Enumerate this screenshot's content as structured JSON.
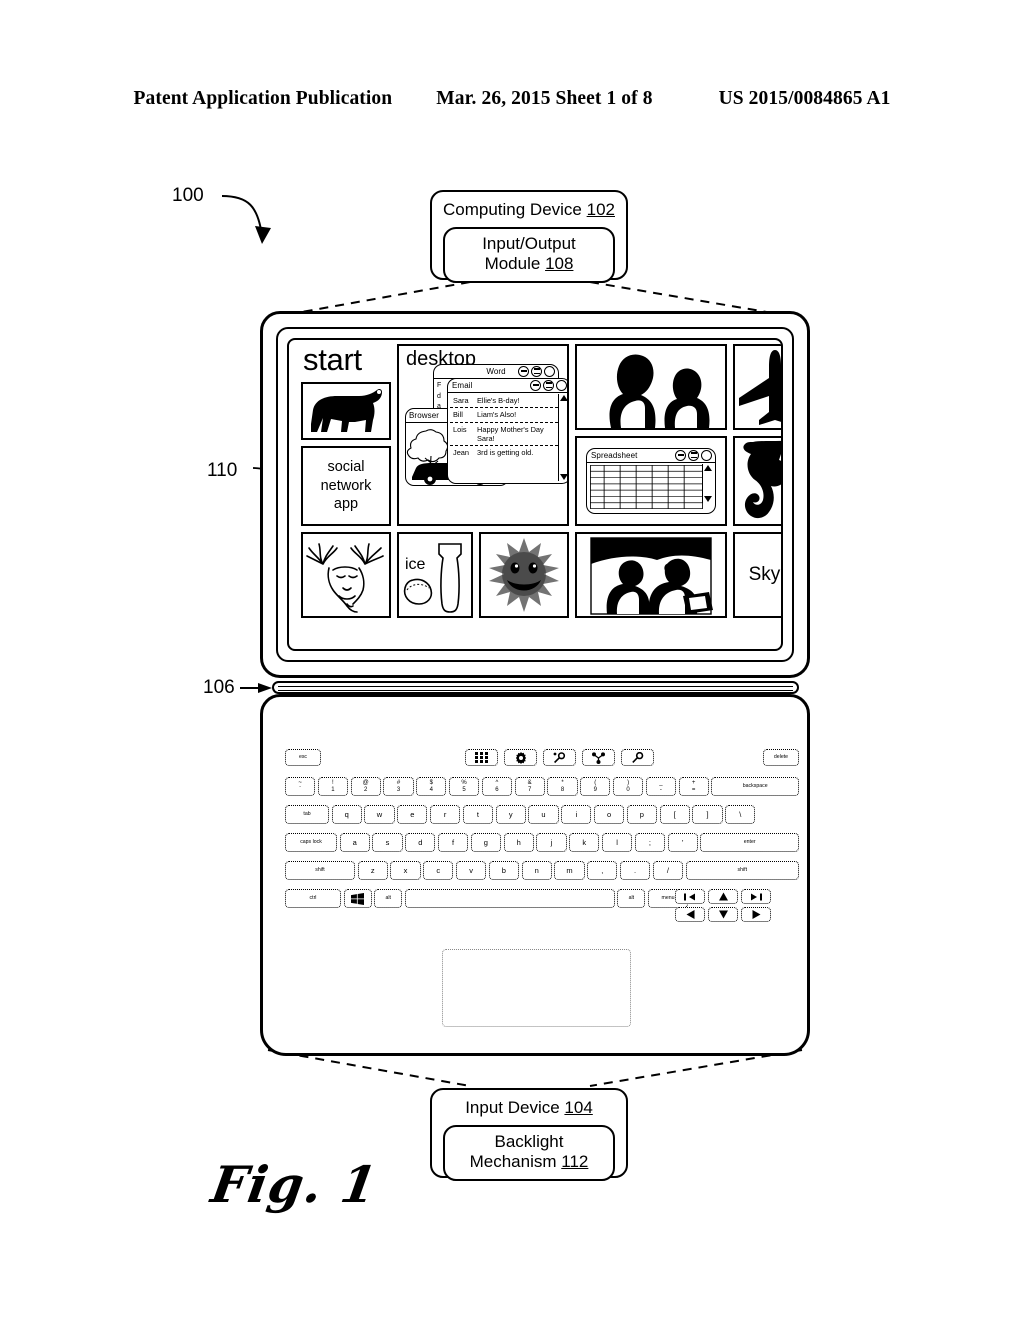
{
  "header": {
    "publication": "Patent Application Publication",
    "date_sheet": "Mar. 26, 2015  Sheet 1 of 8",
    "pub_number": "US 2015/0084865 A1"
  },
  "figure": {
    "caption": "Fig. 1",
    "reference_numerals": {
      "system": "100",
      "input_device": "104",
      "hinge": "106",
      "display_device": "110"
    }
  },
  "callout_top": {
    "title": "Computing Device",
    "title_num": "102",
    "inner_line1": "Input/Output",
    "inner_line2": "Module",
    "inner_num": "108"
  },
  "callout_bottom": {
    "title": "Input Device",
    "title_num": "104",
    "inner_line1": "Backlight",
    "inner_line2": "Mechanism",
    "inner_num": "112"
  },
  "start_screen": {
    "start_label": "start",
    "tiles": [
      {
        "name": "dog-tile",
        "label": "",
        "icon": "dog-silhouette"
      },
      {
        "name": "social-network-tile",
        "label": "social network app",
        "icon": "text"
      },
      {
        "name": "deer-tile",
        "label": "",
        "icon": "deer-head"
      },
      {
        "name": "desktop-tile",
        "label": "desktop",
        "icon": "windows-group"
      },
      {
        "name": "ice-tile",
        "label": "ice",
        "icon": "cocktail-shaker-lime"
      },
      {
        "name": "emoji-tile",
        "label": "",
        "icon": "smiley-sun"
      },
      {
        "name": "people-tile",
        "label": "",
        "icon": "father-and-child-photo"
      },
      {
        "name": "spreadsheet-tile",
        "label": "Spreadsheet",
        "icon": "spreadsheet-window"
      },
      {
        "name": "family-tile",
        "label": "",
        "icon": "family-group-photo"
      },
      {
        "name": "airplane-tile",
        "label": "",
        "icon": "airplane-silhouette"
      },
      {
        "name": "monkey-tile",
        "label": "",
        "icon": "monkey-silhouette"
      },
      {
        "name": "skype-tile",
        "label": "Skype",
        "icon": "text"
      }
    ],
    "social_lines": [
      "social",
      "network",
      "app"
    ],
    "desktop_label": "desktop",
    "ice_label": "ice",
    "skype_label": "Skype",
    "windows": {
      "word": {
        "title": "Word"
      },
      "browser": {
        "title": "Browser"
      },
      "spreadsheet": {
        "title": "Spreadsheet"
      },
      "email": {
        "title": "Email",
        "messages": [
          {
            "sender": "Sara",
            "subject": "Ellie's B-day!"
          },
          {
            "sender": "Bill",
            "subject": "Liam's Also!"
          },
          {
            "sender": "Lois",
            "subject": "Happy Mother's Day Sara!"
          },
          {
            "sender": "Jean",
            "subject": "3rd is getting old."
          }
        ]
      }
    }
  },
  "keyboard": {
    "fn_row": [
      {
        "label": "esc",
        "icon": ""
      },
      {
        "label": "",
        "icon": "start-grid-icon"
      },
      {
        "label": "",
        "icon": "gear-icon"
      },
      {
        "label": "",
        "icon": "magnifier-icon"
      },
      {
        "label": "",
        "icon": "share-icon"
      },
      {
        "label": "",
        "icon": "search-icon"
      },
      {
        "label": "delete",
        "icon": ""
      }
    ],
    "number_row": [
      {
        "top": "~",
        "bottom": "`"
      },
      {
        "top": "!",
        "bottom": "1"
      },
      {
        "top": "@",
        "bottom": "2"
      },
      {
        "top": "#",
        "bottom": "3"
      },
      {
        "top": "$",
        "bottom": "4"
      },
      {
        "top": "%",
        "bottom": "5"
      },
      {
        "top": "^",
        "bottom": "6"
      },
      {
        "top": "&",
        "bottom": "7"
      },
      {
        "top": "*",
        "bottom": "8"
      },
      {
        "top": "(",
        "bottom": "9"
      },
      {
        "top": ")",
        "bottom": "0"
      },
      {
        "top": "_",
        "bottom": "-"
      },
      {
        "top": "+",
        "bottom": "="
      }
    ],
    "backspace_label": "backspace",
    "q_row": [
      "tab",
      "q",
      "w",
      "e",
      "r",
      "t",
      "y",
      "u",
      "i",
      "o",
      "p",
      "[",
      "]",
      "\\"
    ],
    "tab_label": "tab",
    "a_row": [
      "a",
      "s",
      "d",
      "f",
      "g",
      "h",
      "j",
      "k",
      "l",
      ";",
      "'"
    ],
    "caps_label": "caps lock",
    "enter_label": "enter",
    "z_row": [
      "z",
      "x",
      "c",
      "v",
      "b",
      "n",
      "m",
      ",",
      ".",
      "/"
    ],
    "shift_label": "shift",
    "bottom_row": [
      {
        "label": "ctrl",
        "icon": ""
      },
      {
        "label": "",
        "icon": "windows-logo-icon"
      },
      {
        "label": "alt",
        "icon": ""
      },
      {
        "label": "",
        "icon": "spacebar"
      },
      {
        "label": "alt",
        "icon": ""
      },
      {
        "label": "menu",
        "icon": ""
      }
    ],
    "nav_keys": [
      {
        "label": "",
        "icon": "home-icon"
      },
      {
        "label": "",
        "icon": "arrow-up-icon"
      },
      {
        "label": "",
        "icon": "end-icon"
      },
      {
        "label": "",
        "icon": "arrow-left-icon"
      },
      {
        "label": "",
        "icon": "arrow-down-icon"
      },
      {
        "label": "",
        "icon": "arrow-right-icon"
      }
    ]
  }
}
